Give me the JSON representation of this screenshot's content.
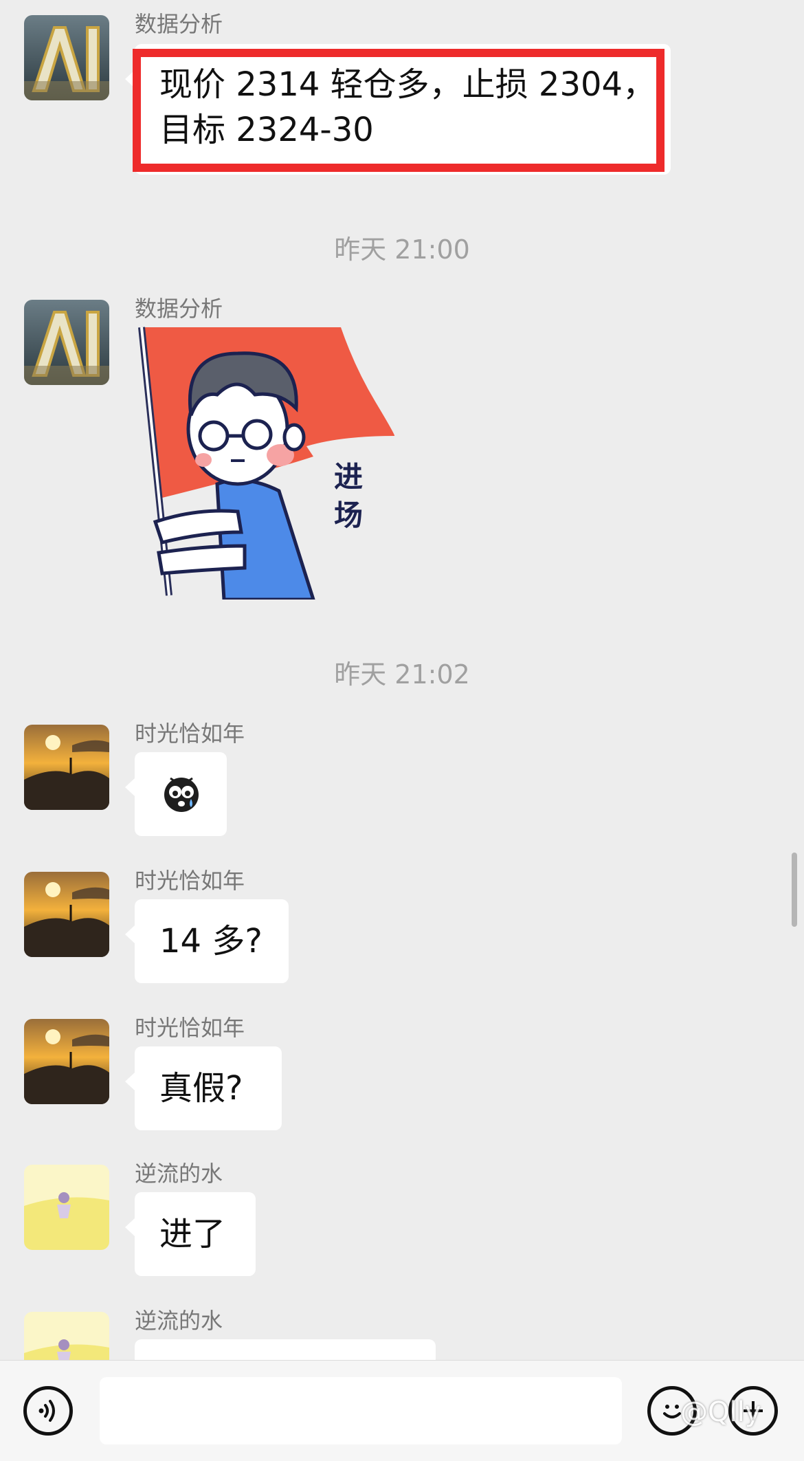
{
  "messages": [
    {
      "sender": "数据分析",
      "text_line1": "现价 2314 轻仓多，止损 2304，",
      "text_line2": "目标 2324-30"
    },
    {
      "sender": "数据分析",
      "sticker_text": "进场"
    },
    {
      "sender": "时光恰如年",
      "emoji": "crying-face-icon"
    },
    {
      "sender": "时光恰如年",
      "text": "14 多?"
    },
    {
      "sender": "时光恰如年",
      "text": "真假?"
    },
    {
      "sender": "逆流的水",
      "text": "进了"
    },
    {
      "sender": "逆流的水",
      "text": ""
    }
  ],
  "timestamps": [
    "昨天 21:00",
    "昨天 21:02"
  ],
  "input_bar": {
    "voice_icon": "voice-icon",
    "emoji_icon": "emoji-icon",
    "add_icon": "add-icon",
    "watermark": "@Qlly"
  },
  "colors": {
    "background": "#ededed",
    "bubble": "#ffffff",
    "highlight": "#ee2b2b",
    "flag": "#ef5a44",
    "shirt": "#4d8ae8"
  }
}
